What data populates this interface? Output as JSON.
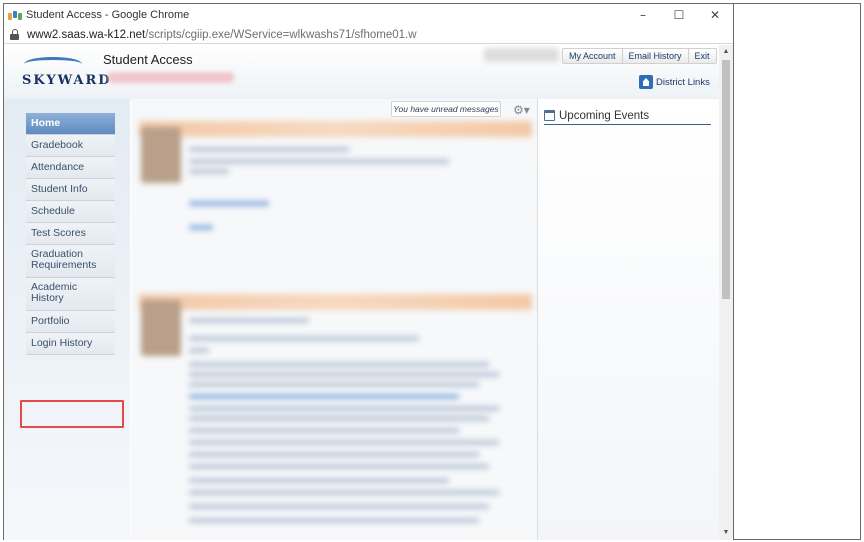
{
  "browser": {
    "title": "Student Access - Google Chrome",
    "url_host": "www2.saas.wa-k12.net",
    "url_path": "/scripts/cgiip.exe/WService=wlkwashs71/sfhome01.w",
    "controls": {
      "minimize": "–",
      "maximize": "☐",
      "close": "✕"
    }
  },
  "header": {
    "logo_text": "SKYWARD",
    "app_title": "Student Access",
    "top_links": [
      "My Account",
      "Email History",
      "Exit"
    ],
    "district_links": "District Links"
  },
  "sidebar": {
    "items": [
      {
        "label": "Home",
        "active": true
      },
      {
        "label": "Gradebook"
      },
      {
        "label": "Attendance"
      },
      {
        "label": "Student Info"
      },
      {
        "label": "Schedule"
      },
      {
        "label": "Test Scores"
      },
      {
        "label": "Graduation Requirements"
      },
      {
        "label": "Academic History"
      },
      {
        "label": "Portfolio",
        "highlighted": true
      },
      {
        "label": "Login History"
      }
    ]
  },
  "feed": {
    "unread_messages": "You have unread messages",
    "gear_icon": "⚙▾"
  },
  "right_panel": {
    "title": "Upcoming Events"
  },
  "colors": {
    "highlight": "#e44a4a",
    "active_nav": "#5e8ac1",
    "brand_navy": "#17325e"
  }
}
